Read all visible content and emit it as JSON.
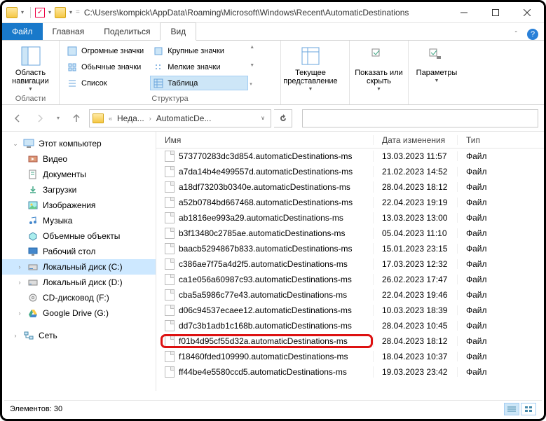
{
  "title_path": "C:\\Users\\kompick\\AppData\\Roaming\\Microsoft\\Windows\\Recent\\AutomaticDestinations",
  "tabs": {
    "file": "Файл",
    "home": "Главная",
    "share": "Поделиться",
    "view": "Вид"
  },
  "ribbon": {
    "nav_pane": "Область навигации",
    "nav_group": "Области",
    "huge_icons": "Огромные значки",
    "large_icons": "Крупные значки",
    "normal_icons": "Обычные значки",
    "small_icons": "Мелкие значки",
    "list": "Список",
    "table": "Таблица",
    "struct_group": "Структура",
    "current_view": "Текущее представление",
    "show_hide": "Показать или скрыть",
    "options": "Параметры"
  },
  "breadcrumb": {
    "p1": "Неда...",
    "p2": "AutomaticDe..."
  },
  "tree": {
    "this_pc": "Этот компьютер",
    "videos": "Видео",
    "documents": "Документы",
    "downloads": "Загрузки",
    "pictures": "Изображения",
    "music": "Музыка",
    "objects3d": "Объемные объекты",
    "desktop": "Рабочий стол",
    "disk_c": "Локальный диск (C:)",
    "disk_d": "Локальный диск (D:)",
    "cd_f": "CD-дисковод (F:)",
    "gdrive": "Google Drive (G:)",
    "network": "Сеть"
  },
  "columns": {
    "name": "Имя",
    "date": "Дата изменения",
    "type": "Тип"
  },
  "type_label": "Файл",
  "files": [
    {
      "name": "573770283dc3d854.automaticDestinations-ms",
      "date": "13.03.2023 11:57"
    },
    {
      "name": "a7da14b4e499557d.automaticDestinations-ms",
      "date": "21.02.2023 14:52"
    },
    {
      "name": "a18df73203b0340e.automaticDestinations-ms",
      "date": "28.04.2023 18:12"
    },
    {
      "name": "a52b0784bd667468.automaticDestinations-ms",
      "date": "22.04.2023 19:19"
    },
    {
      "name": "ab1816ee993a29.automaticDestinations-ms",
      "date": "13.03.2023 13:00"
    },
    {
      "name": "b3f13480c2785ae.automaticDestinations-ms",
      "date": "05.04.2023 11:10"
    },
    {
      "name": "baacb5294867b833.automaticDestinations-ms",
      "date": "15.01.2023 23:15"
    },
    {
      "name": "c386ae7f75a4d2f5.automaticDestinations-ms",
      "date": "17.03.2023 12:32"
    },
    {
      "name": "ca1e056a60987c93.automaticDestinations-ms",
      "date": "26.02.2023 17:47"
    },
    {
      "name": "cba5a5986c77e43.automaticDestinations-ms",
      "date": "22.04.2023 19:46"
    },
    {
      "name": "d06c94537ecaee12.automaticDestinations-ms",
      "date": "10.03.2023 18:39"
    },
    {
      "name": "dd7c3b1adb1c168b.automaticDestinations-ms",
      "date": "28.04.2023 10:45"
    },
    {
      "name": "f01b4d95cf55d32a.automaticDestinations-ms",
      "date": "28.04.2023 18:12",
      "highlight": true
    },
    {
      "name": "f18460fded109990.automaticDestinations-ms",
      "date": "18.04.2023 10:37"
    },
    {
      "name": "ff44be4e5580ccd5.automaticDestinations-ms",
      "date": "19.03.2023 23:42"
    }
  ],
  "status": {
    "items_label": "Элементов:",
    "count": "30"
  }
}
